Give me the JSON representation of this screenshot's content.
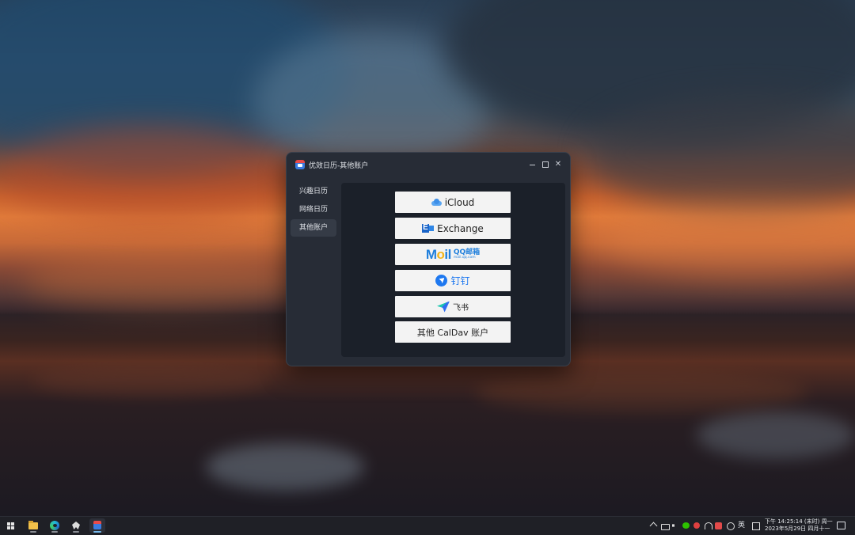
{
  "window": {
    "title": "优效日历-其他账户",
    "controls": {
      "minimize": "",
      "maximize": "",
      "close": "✕"
    }
  },
  "sidebar": {
    "items": [
      {
        "label": "兴趣日历",
        "active": false
      },
      {
        "label": "网络日历",
        "active": false
      },
      {
        "label": "其他账户",
        "active": true
      }
    ]
  },
  "accounts": {
    "icloud": {
      "label": "iCloud",
      "icon": "icloud-icon"
    },
    "exchange": {
      "label": "Exchange",
      "icon": "exchange-icon"
    },
    "qqmail": {
      "word_m": "M",
      "word_o": "o",
      "word_il": "il",
      "brand": "QQ邮箱",
      "domain": "mail.qq.com",
      "icon": "qq-mail-logo"
    },
    "dingtalk": {
      "label": "钉钉",
      "icon": "dingtalk-icon"
    },
    "feishu": {
      "label": "飞书",
      "icon": "feishu-icon"
    },
    "caldav": {
      "label": "其他 CalDav 账户"
    }
  },
  "taskbar": {
    "apps": [
      "start-icon",
      "file-explorer-icon",
      "edge-icon",
      "game-icon",
      "calendar-app-icon"
    ],
    "tray": {
      "ime": "英",
      "clock_line1": "下午 14:25:14 (末时) 周一",
      "clock_line2": "2023年5月29日 四月十一"
    }
  },
  "colors": {
    "window_bg": "#272c36",
    "content_bg": "#1b2029",
    "button_bg": "#f3f3f3",
    "accent_blue": "#1e78f0",
    "taskbar_bg": "#1f2026"
  }
}
